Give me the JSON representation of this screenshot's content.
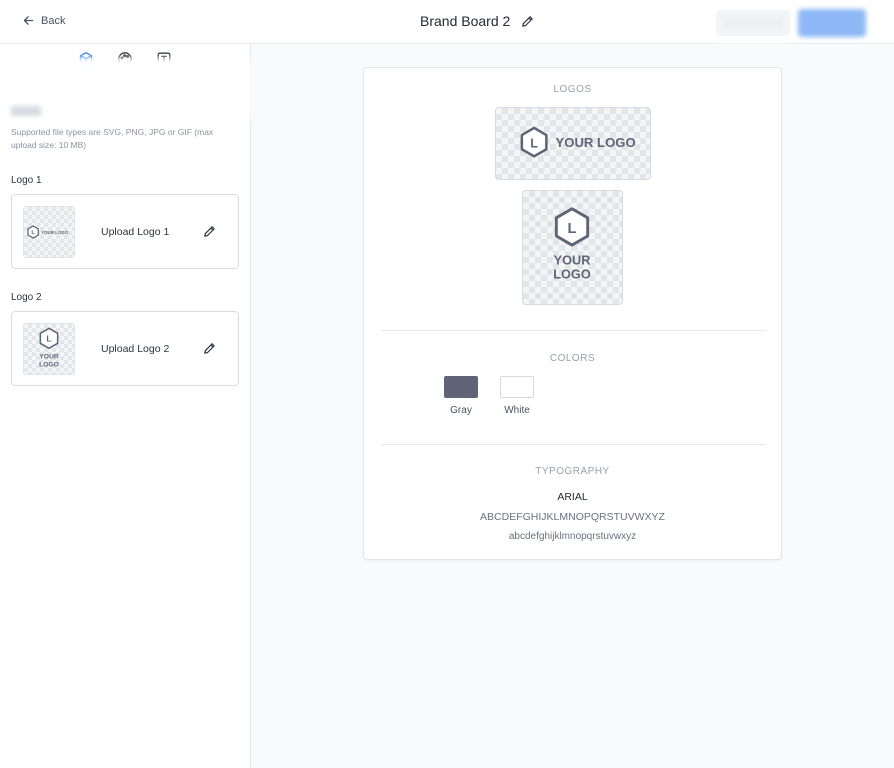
{
  "header": {
    "back_label": "Back",
    "title": "Brand Board 2"
  },
  "sidebar": {
    "tabs": [
      {
        "icon": "logo-cube-icon",
        "active": true
      },
      {
        "icon": "palette-icon",
        "active": false
      },
      {
        "icon": "typography-icon",
        "active": false
      }
    ],
    "helper_text": "Supported file types are SVG, PNG, JPG or GIF (max upload size: 10 MB)",
    "logos": [
      {
        "label": "Logo 1",
        "upload_label": "Upload Logo 1",
        "variant": "horizontal"
      },
      {
        "label": "Logo 2",
        "upload_label": "Upload Logo 2",
        "variant": "stacked"
      }
    ]
  },
  "board": {
    "logos_title": "LOGOS",
    "placeholder_logo": {
      "mark": "L",
      "text_line1": "YOUR",
      "text_line2": "LOGO",
      "text_single": "YOUR LOGO"
    },
    "colors_title": "COLORS",
    "colors": [
      {
        "name": "Gray",
        "hex": "#5f6577"
      },
      {
        "name": "White",
        "hex": "#ffffff"
      }
    ],
    "typography_title": "TYPOGRAPHY",
    "font_name": "ARIAL",
    "uppercase_sample": "ABCDEFGHIJKLMNOPQRSTUVWXYZ",
    "lowercase_sample": "abcdefghijklmnopqrstuvwxyz"
  },
  "theme": {
    "accent": "#3b82f6",
    "logo_gray": "#5f6577"
  }
}
